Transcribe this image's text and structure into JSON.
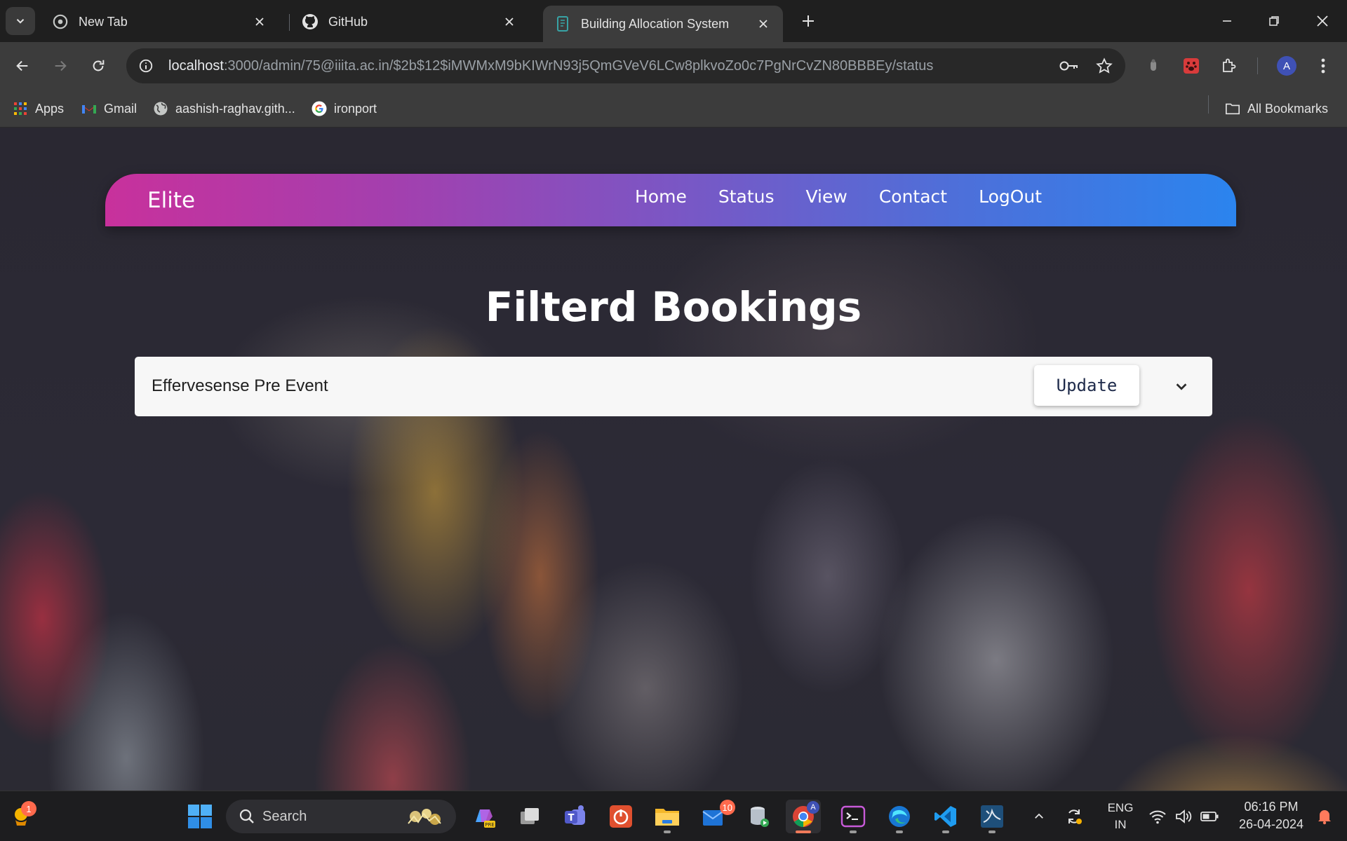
{
  "browser": {
    "tabs": [
      {
        "title": "New Tab"
      },
      {
        "title": "GitHub"
      },
      {
        "title": "Building Allocation System"
      }
    ],
    "url": {
      "host": "localhost",
      "rest": ":3000/admin/75@iiita.ac.in/$2b$12$iMWMxM9bKIWrN93j5QmGVeV6LCw8plkvoZo0c7PgNrCvZN80BBBEy/status"
    },
    "bookmarks": [
      {
        "label": "Apps"
      },
      {
        "label": "Gmail"
      },
      {
        "label": "aashish-raghav.gith..."
      },
      {
        "label": "ironport"
      }
    ],
    "all_bookmarks": "All Bookmarks",
    "profile_initial": "A"
  },
  "site": {
    "brand": "Elite",
    "nav": [
      "Home",
      "Status",
      "View",
      "Contact",
      "LogOut"
    ],
    "heading": "Filterd Bookings",
    "bookings": [
      {
        "name": "Effervesense Pre Event",
        "action": "Update"
      }
    ]
  },
  "taskbar": {
    "search_label": "Search",
    "widget_badge": "1",
    "mail_badge": "10",
    "language": "ENG",
    "region": "IN",
    "time": "06:16 PM",
    "date": "26-04-2024",
    "profile_initial": "A"
  },
  "colors": {
    "nav_gradient_start": "#c8319c",
    "nav_gradient_end": "#2b84ee",
    "card_bg": "#f7f7f7",
    "chrome_bg": "#3c3c3c"
  }
}
